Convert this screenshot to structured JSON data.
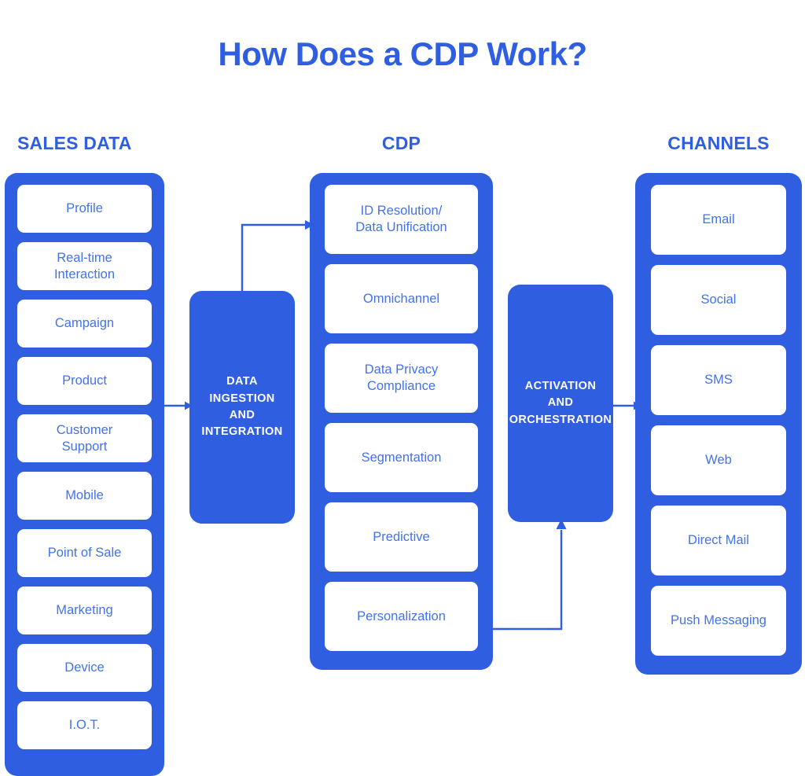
{
  "title": "How Does a CDP Work?",
  "accent_color": "#2f5ee0",
  "card_text_color": "#4272ec",
  "background_color": "#ffffff",
  "columns": {
    "sales": {
      "header": "SALES DATA",
      "items": [
        {
          "label": "Profile"
        },
        {
          "label": "Real-time\nInteraction"
        },
        {
          "label": "Campaign"
        },
        {
          "label": "Product"
        },
        {
          "label": "Customer\nSupport"
        },
        {
          "label": "Mobile"
        },
        {
          "label": "Point of Sale"
        },
        {
          "label": "Marketing"
        },
        {
          "label": "Device"
        },
        {
          "label": "I.O.T."
        }
      ]
    },
    "cdp": {
      "header": "CDP",
      "items": [
        {
          "label": "ID Resolution/\nData Unification"
        },
        {
          "label": "Omnichannel"
        },
        {
          "label": "Data Privacy\nCompliance"
        },
        {
          "label": "Segmentation"
        },
        {
          "label": "Predictive"
        },
        {
          "label": "Personalization"
        }
      ]
    },
    "channels": {
      "header": "CHANNELS",
      "items": [
        {
          "label": "Email"
        },
        {
          "label": "Social"
        },
        {
          "label": "SMS"
        },
        {
          "label": "Web"
        },
        {
          "label": "Direct Mail"
        },
        {
          "label": "Push Messaging"
        }
      ]
    }
  },
  "process_blocks": {
    "ingestion": "DATA\nINGESTION\nAND\nINTEGRATION",
    "activation": "ACTIVATION\nAND\nORCHESTRATION"
  }
}
